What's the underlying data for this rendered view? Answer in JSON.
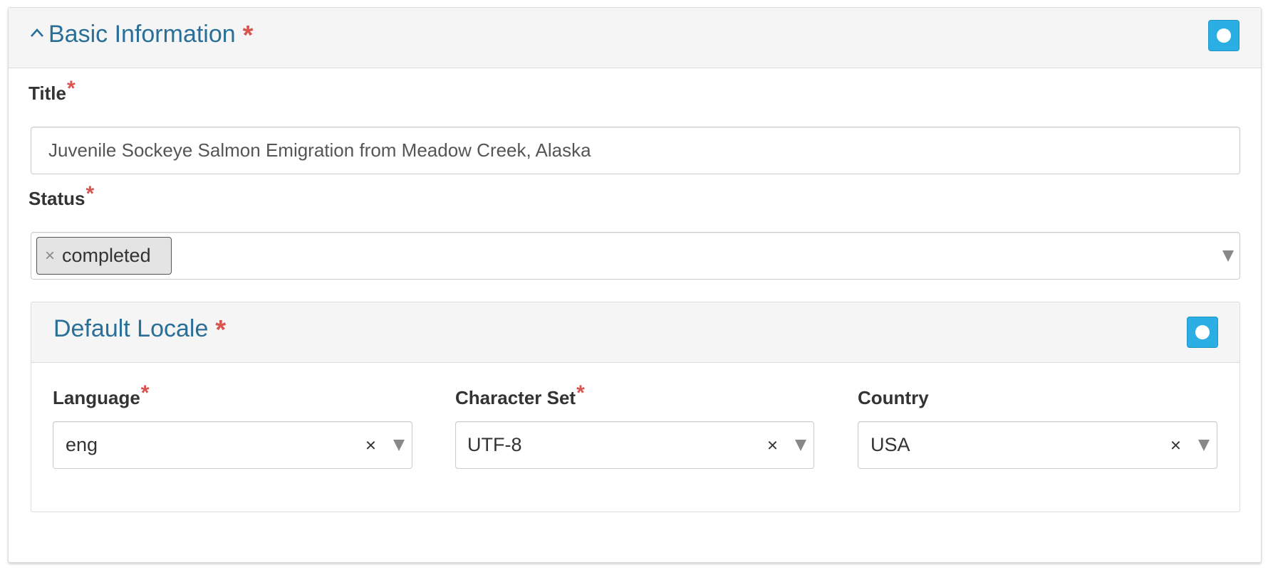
{
  "section": {
    "title": "Basic Information",
    "required_mark": "*"
  },
  "title_field": {
    "label": "Title",
    "required_mark": "*",
    "value": "Juvenile Sockeye Salmon Emigration from Meadow Creek, Alaska"
  },
  "status_field": {
    "label": "Status",
    "required_mark": "*",
    "tags": [
      {
        "label": "completed",
        "remove_glyph": "×"
      }
    ]
  },
  "locale": {
    "title": "Default Locale",
    "required_mark": "*",
    "fields": [
      {
        "label": "Language",
        "required_mark": "*",
        "value": "eng",
        "clear_glyph": "×"
      },
      {
        "label": "Character Set",
        "required_mark": "*",
        "value": "UTF-8",
        "clear_glyph": "×"
      },
      {
        "label": "Country",
        "required_mark": "",
        "value": "USA",
        "clear_glyph": "×"
      }
    ]
  },
  "colors": {
    "heading_text": "#2a6f97",
    "required_star": "#d9534f",
    "toggle_button": "#2aaee3"
  },
  "icons": {
    "collapse": "chevron-up-icon",
    "toggle": "circle-toggle-icon",
    "dropdown": "caret-down-icon",
    "clear": "close-icon"
  }
}
